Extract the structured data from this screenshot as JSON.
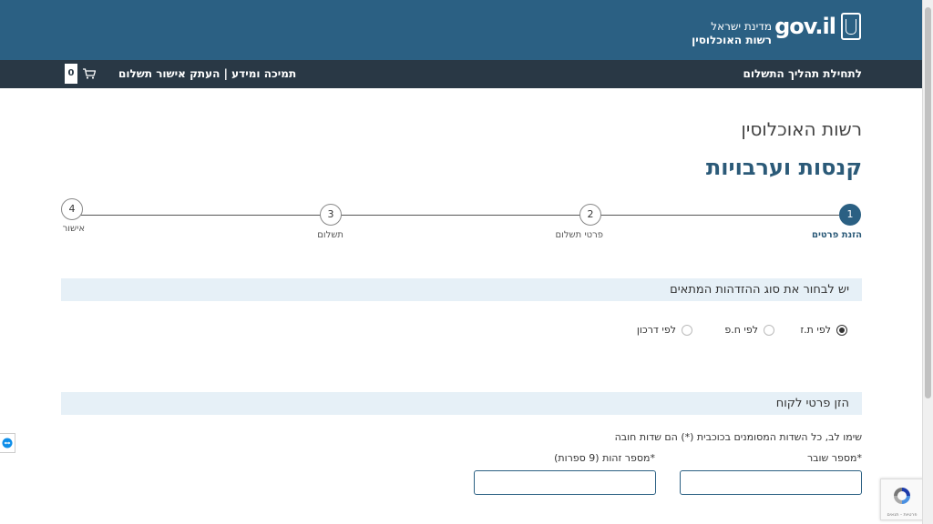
{
  "header": {
    "logo_text": "gov.il",
    "org_line1": "מדינת ישראל",
    "org_line2": "רשות האוכלוסין"
  },
  "nav": {
    "start_link": "לתחילת תהליך התשלום",
    "support_link": "תמיכה ומידע",
    "separator": "|",
    "copy_link": "העתק אישור תשלום",
    "cart_count": "0"
  },
  "page": {
    "sup_title": "רשות האוכלוסין",
    "main_title": "קנסות וערבויות"
  },
  "steps": [
    {
      "number": "1",
      "label": "הזנת פרטים",
      "active": true
    },
    {
      "number": "2",
      "label": "פרטי תשלום",
      "active": false
    },
    {
      "number": "3",
      "label": "תשלום",
      "active": false
    },
    {
      "number": "4",
      "label": "אישור",
      "active": false
    }
  ],
  "id_section": {
    "title": "יש לבחור את סוג ההזדהות המתאים",
    "options": [
      {
        "label": "לפי ת.ז",
        "checked": true
      },
      {
        "label": "לפי ח.פ",
        "checked": false
      },
      {
        "label": "לפי דרכון",
        "checked": false
      }
    ]
  },
  "customer_section": {
    "title": "הזן פרטי לקוח",
    "note": "שימו לב, כל השדות המסומנים בכוכבית (*) הם שדות חובה",
    "fields": [
      {
        "label": "*מספר שובר",
        "value": ""
      },
      {
        "label": "*מספר זהות (9 ספרות)",
        "value": ""
      }
    ]
  },
  "recaptcha": {
    "footer": "פרטיות - תנאים"
  },
  "colors": {
    "header_bg": "#2b6083",
    "nav_bg": "#293845",
    "accent": "#2b5a78",
    "section_bg": "#e6f0f7"
  }
}
